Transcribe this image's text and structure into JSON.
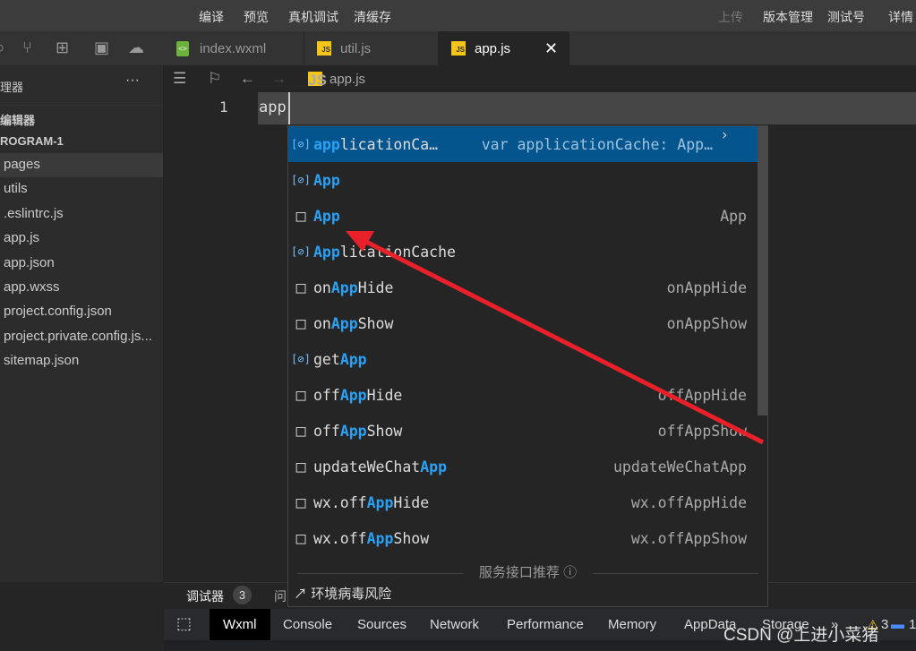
{
  "toolbar": {
    "compile": "编译",
    "preview": "预览",
    "remote_debug": "真机调试",
    "clear_cache": "清缓存",
    "upload": "上传",
    "version": "版本管理",
    "test_account": "测试号",
    "details": "详情"
  },
  "tabs": [
    {
      "label": "index.wxml",
      "icon": "wxml-file-icon"
    },
    {
      "label": "util.js",
      "icon": "js-file-icon"
    },
    {
      "label": "app.js",
      "icon": "js-file-icon",
      "active": true
    }
  ],
  "breadcrumb": {
    "file": "app.js"
  },
  "sidebar": {
    "title": "理器",
    "section_open": "编辑器",
    "project": "ROGRAM-1",
    "items": [
      "pages",
      "utils",
      ".eslintrc.js",
      "app.js",
      "app.json",
      "app.wxss",
      "project.config.json",
      "project.private.config.js...",
      "sitemap.json"
    ]
  },
  "editor": {
    "line_number": "1",
    "code": "app"
  },
  "suggest": {
    "items": [
      {
        "kind": "variable",
        "pre": "app",
        "rest": "licationCa…",
        "detail": "var applicationCache: App…",
        "selected": true
      },
      {
        "kind": "variable",
        "pre": "App",
        "rest": "",
        "detail": ""
      },
      {
        "kind": "keyword",
        "pre": "App",
        "rest": "",
        "detail": "App"
      },
      {
        "kind": "variable",
        "pre": "App",
        "rest": "licationCache",
        "detail": ""
      },
      {
        "kind": "keyword",
        "lead": "on",
        "pre": "App",
        "rest": "Hide",
        "detail": "onAppHide"
      },
      {
        "kind": "keyword",
        "lead": "on",
        "pre": "App",
        "rest": "Show",
        "detail": "onAppShow"
      },
      {
        "kind": "variable",
        "lead": "get",
        "pre": "App",
        "rest": "",
        "detail": ""
      },
      {
        "kind": "keyword",
        "lead": "off",
        "pre": "App",
        "rest": "Hide",
        "detail": "offAppHide"
      },
      {
        "kind": "keyword",
        "lead": "off",
        "pre": "App",
        "rest": "Show",
        "detail": "offAppShow"
      },
      {
        "kind": "keyword",
        "lead": "updateWeChat",
        "pre": "App",
        "rest": "",
        "detail": "updateWeChatApp"
      },
      {
        "kind": "keyword",
        "lead": "wx.off",
        "pre": "App",
        "rest": "Hide",
        "detail": "wx.offAppHide"
      },
      {
        "kind": "keyword",
        "lead": "wx.off",
        "pre": "App",
        "rest": "Show",
        "detail": "wx.offAppShow"
      }
    ],
    "footer": "服务接口推荐",
    "env": "环境病毒风险"
  },
  "debugger": {
    "title": "调试器",
    "count": "3",
    "next": "问"
  },
  "devtools": {
    "tabs": [
      "Wxml",
      "Console",
      "Sources",
      "Network",
      "Performance",
      "Memory",
      "AppData",
      "Storage"
    ],
    "more": "»",
    "warnings": "3",
    "info": "1"
  },
  "watermark": "CSDN @上进小菜猪",
  "colors": {
    "accent": "#2aa1f5",
    "selection": "#04558e",
    "arrow": "#e8202a"
  }
}
